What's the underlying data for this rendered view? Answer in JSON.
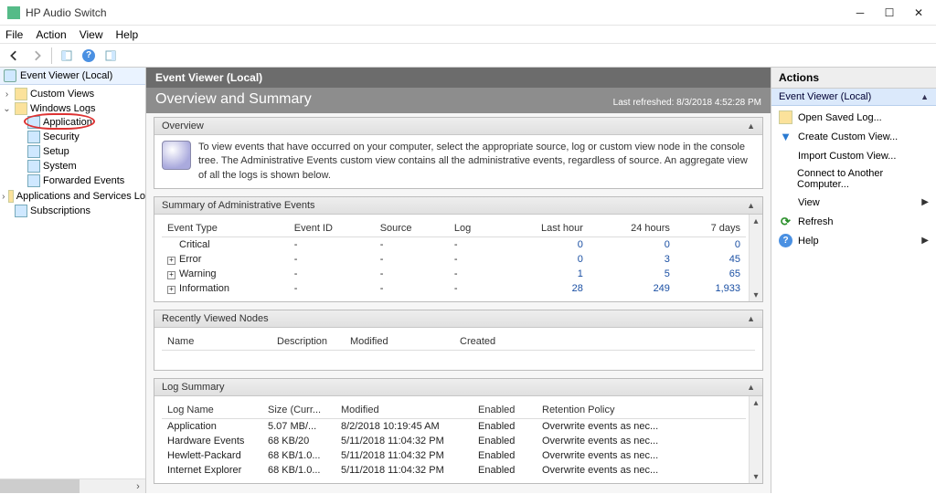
{
  "window": {
    "title": "HP Audio Switch"
  },
  "menu": {
    "file": "File",
    "action": "Action",
    "view": "View",
    "help": "Help"
  },
  "tree": {
    "root": "Event Viewer (Local)",
    "custom_views": "Custom Views",
    "windows_logs": "Windows Logs",
    "application": "Application",
    "security": "Security",
    "setup": "Setup",
    "system": "System",
    "forwarded": "Forwarded Events",
    "apps_services": "Applications and Services Lo",
    "subscriptions": "Subscriptions"
  },
  "center": {
    "title": "Event Viewer (Local)",
    "overview_title": "Overview and Summary",
    "last_refreshed": "Last refreshed: 8/3/2018 4:52:28 PM",
    "overview_head": "Overview",
    "overview_text": "To view events that have occurred on your computer, select the appropriate source, log or custom view node in the console tree. The Administrative Events custom view contains all the administrative events, regardless of source. An aggregate view of all the logs is shown below.",
    "summary_head": "Summary of Administrative Events",
    "summary_cols": {
      "type": "Event Type",
      "id": "Event ID",
      "source": "Source",
      "log": "Log",
      "h1": "Last hour",
      "h24": "24 hours",
      "d7": "7 days"
    },
    "summary_rows": [
      {
        "type": "Critical",
        "id": "-",
        "source": "-",
        "log": "-",
        "h1": "0",
        "h24": "0",
        "d7": "0",
        "expand": false
      },
      {
        "type": "Error",
        "id": "-",
        "source": "-",
        "log": "-",
        "h1": "0",
        "h24": "3",
        "d7": "45",
        "expand": true
      },
      {
        "type": "Warning",
        "id": "-",
        "source": "-",
        "log": "-",
        "h1": "1",
        "h24": "5",
        "d7": "65",
        "expand": true
      },
      {
        "type": "Information",
        "id": "-",
        "source": "-",
        "log": "-",
        "h1": "28",
        "h24": "249",
        "d7": "1,933",
        "expand": true
      }
    ],
    "recent_head": "Recently Viewed Nodes",
    "recent_cols": {
      "name": "Name",
      "desc": "Description",
      "mod": "Modified",
      "created": "Created"
    },
    "logsum_head": "Log Summary",
    "logsum_cols": {
      "name": "Log Name",
      "size": "Size (Curr...",
      "mod": "Modified",
      "enabled": "Enabled",
      "ret": "Retention Policy"
    },
    "logsum_rows": [
      {
        "name": "Application",
        "size": "5.07 MB/...",
        "mod": "8/2/2018 10:19:45 AM",
        "enabled": "Enabled",
        "ret": "Overwrite events as nec..."
      },
      {
        "name": "Hardware Events",
        "size": "68 KB/20",
        "mod": "5/11/2018 11:04:32 PM",
        "enabled": "Enabled",
        "ret": "Overwrite events as nec..."
      },
      {
        "name": "Hewlett-Packard",
        "size": "68 KB/1.0...",
        "mod": "5/11/2018 11:04:32 PM",
        "enabled": "Enabled",
        "ret": "Overwrite events as nec..."
      },
      {
        "name": "Internet Explorer",
        "size": "68 KB/1.0...",
        "mod": "5/11/2018 11:04:32 PM",
        "enabled": "Enabled",
        "ret": "Overwrite events as nec..."
      }
    ]
  },
  "actions": {
    "title": "Actions",
    "subtitle": "Event Viewer (Local)",
    "open_saved": "Open Saved Log...",
    "create_view": "Create Custom View...",
    "import_view": "Import Custom View...",
    "connect": "Connect to Another Computer...",
    "view": "View",
    "refresh": "Refresh",
    "help": "Help"
  }
}
